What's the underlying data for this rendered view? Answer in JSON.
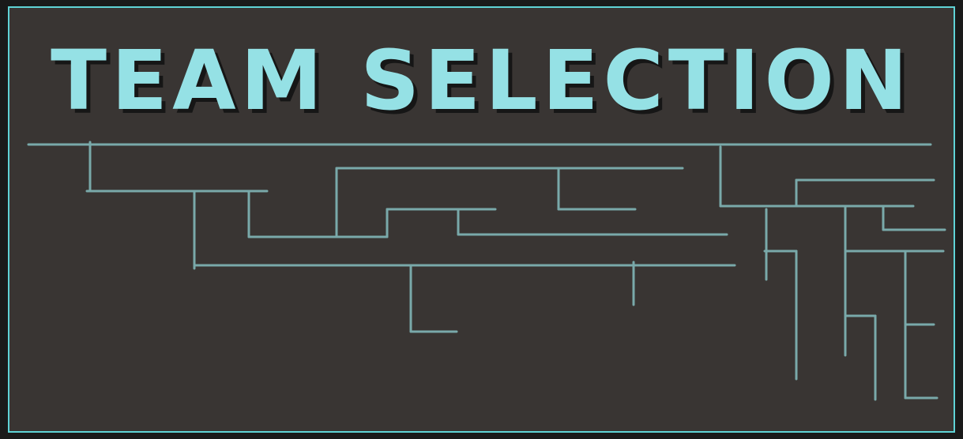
{
  "screen": {
    "title": "TEAM SELECTION"
  },
  "colors": {
    "border": "#5fd3d6",
    "panel_background": "#393533",
    "title_text": "#95e1e5",
    "circuit_lines": "#79a9aa"
  }
}
